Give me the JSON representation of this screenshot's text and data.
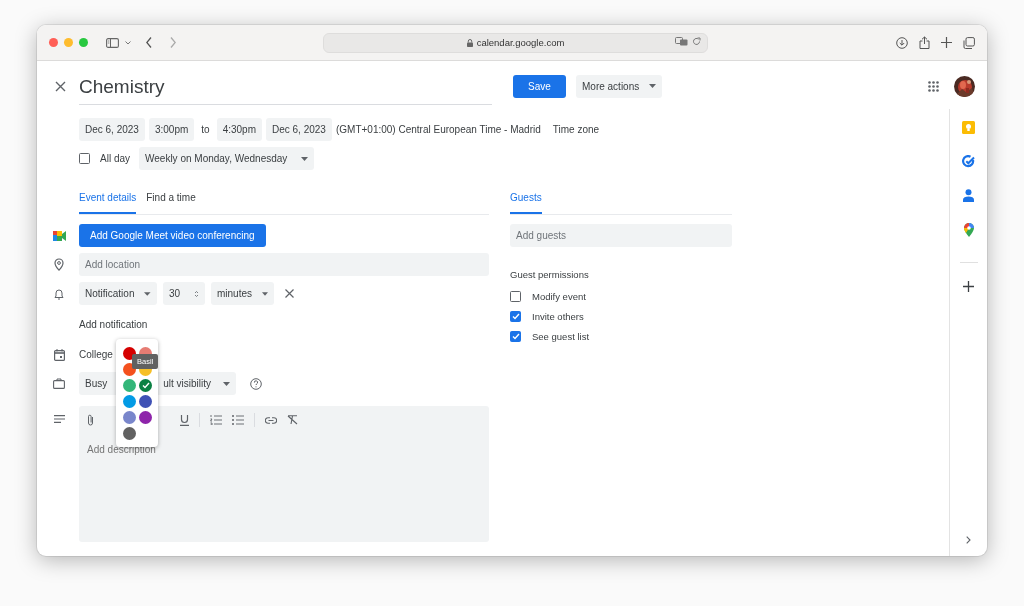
{
  "browser": {
    "url": "calendar.google.com"
  },
  "event": {
    "title": "Chemistry"
  },
  "header_buttons": [
    {
      "label": "Save",
      "kind": "primary"
    },
    {
      "label": "More actions",
      "kind": "menu"
    }
  ],
  "datetime": {
    "start_date": "Dec 6, 2023",
    "start_time": "3:00pm",
    "separator": "to",
    "end_time": "4:30pm",
    "end_date": "Dec 6, 2023",
    "timezone": "(GMT+01:00) Central European Time - Madrid",
    "timezone_link": "Time zone"
  },
  "all_day": {
    "label": "All day",
    "checked": false
  },
  "recurrence": "Weekly on Monday, Wednesday",
  "tabs": [
    {
      "label": "Event details",
      "selected": true
    },
    {
      "label": "Find a time",
      "selected": false
    }
  ],
  "meet_button": "Add Google Meet video conferencing",
  "location": {
    "placeholder": "Add location"
  },
  "notification": {
    "type": "Notification",
    "amount": "30",
    "unit": "minutes"
  },
  "add_notification": "Add notification",
  "calendar": "College",
  "availability": "Busy",
  "visibility": "ult visibility",
  "description": {
    "placeholder": "Add description"
  },
  "color_picker": {
    "tooltip": "Basil",
    "colors": [
      {
        "color": "#d50000",
        "selected": false
      },
      {
        "color": "#e67c73",
        "selected": false
      },
      {
        "color": "#f4511e",
        "selected": false
      },
      {
        "color": "#f6bf26",
        "selected": false
      },
      {
        "color": "#33b679",
        "selected": false
      },
      {
        "color": "#0b8043",
        "selected": true
      },
      {
        "color": "#039be5",
        "selected": false
      },
      {
        "color": "#3f51b5",
        "selected": false
      },
      {
        "color": "#7986cb",
        "selected": false
      },
      {
        "color": "#8e24aa",
        "selected": false
      },
      {
        "color": "#616161",
        "selected": false
      }
    ]
  },
  "guests": {
    "tab": {
      "label": "Guests",
      "selected": true
    },
    "placeholder": "Add guests",
    "permissions_title": "Guest permissions",
    "permissions": [
      {
        "label": "Modify event",
        "checked": false
      },
      {
        "label": "Invite others",
        "checked": true
      },
      {
        "label": "See guest list",
        "checked": true
      }
    ]
  }
}
